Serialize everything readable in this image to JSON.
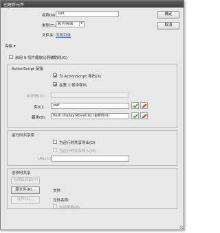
{
  "window": {
    "title": "创建新元件"
  },
  "symbol": {
    "name_label": "名称(N):",
    "name_value": "swf",
    "type_label": "类型(T):",
    "type_value": "影片剪辑",
    "folder_label": "文件夹:",
    "folder_link": "库根目录"
  },
  "buttons": {
    "ok": "确定",
    "cancel": "取消"
  },
  "advanced": {
    "toggle": "高级 ▾",
    "scale9": "启用 9 切片缩放比例辅助线(G)",
    "linkage": {
      "header": "ActionScript 链接",
      "export_as": "为 ActionScript 导出(X)",
      "export_frame1": "在第 1 帧中导出",
      "identifier_label": "标识符(D):",
      "identifier_value": "",
      "class_label": "类(C):",
      "class_value": "swf",
      "base_label": "基类(B):",
      "base_value": "flash.display.MovieClip    (更新时间)"
    },
    "runtime_shared": {
      "header": "运行时共享库",
      "export_sharing": "为运行时共享导出(O)",
      "import_sharing": "为运行时共享导入(M)",
      "url_label": "URL(U):",
      "url_value": ""
    },
    "authoring": {
      "header": "创作时共享",
      "share_with_project": "与项目共享(H)",
      "source_file_button": "源文件(R)...",
      "file_label": "文件:",
      "symbol_button": "元件(S)...",
      "symbol_name_label": "元件名称:",
      "auto_update": "自动更新(A)"
    }
  },
  "colors": {
    "accent_link": "#2a5db0",
    "check_green": "#3a9a2a",
    "pencil_orange": "#c8501e"
  }
}
